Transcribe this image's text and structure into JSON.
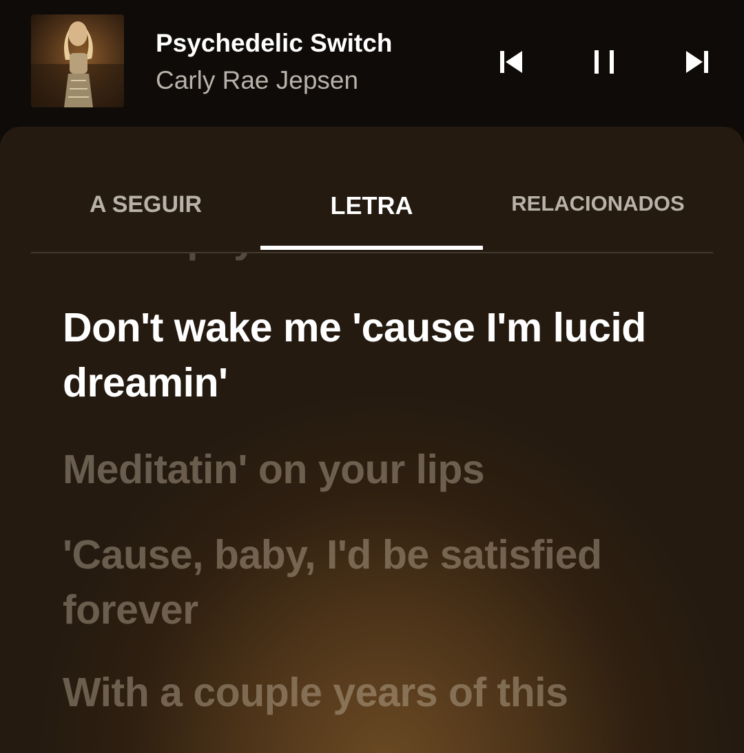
{
  "player": {
    "title": "Psychedelic Switch",
    "artist": "Carly Rae Jepsen",
    "controls": {
      "previous_icon": "skip-previous-icon",
      "pause_icon": "pause-icon",
      "next_icon": "skip-next-icon"
    }
  },
  "tabs": [
    {
      "label": "A SEGUIR",
      "selected": false
    },
    {
      "label": "LETRA",
      "selected": true
    },
    {
      "label": "RELACIONADOS",
      "selected": false
    }
  ],
  "lyrics": {
    "partial_line": "Like a psychedelic switch",
    "active_line": "Don't wake me 'cause I'm lucid dreamin'",
    "lines": [
      "Meditatin' on your lips",
      "'Cause, baby, I'd be satisfied forever",
      "With a couple years of this"
    ]
  },
  "colors": {
    "background": "#0e0b08",
    "sheet_glow": "#6b4a24",
    "active_text": "#ffffff",
    "inactive_text": "#b9b2a9"
  }
}
